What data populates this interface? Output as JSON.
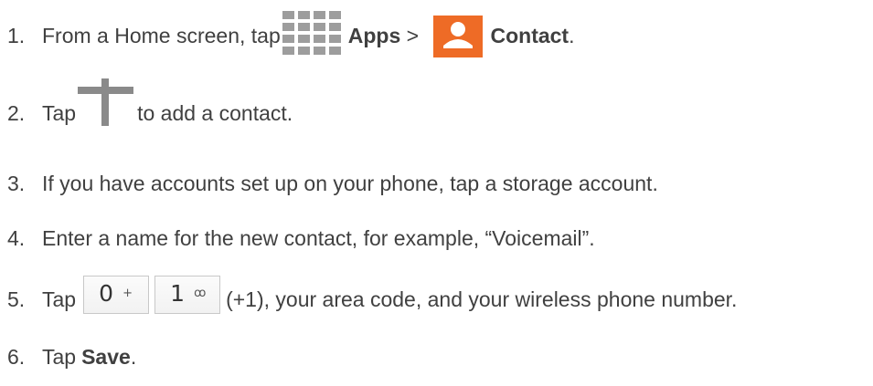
{
  "steps": [
    {
      "num": "1.",
      "pre": "From a Home screen, tap",
      "apps_label": "Apps",
      "sep": " > ",
      "contact_label": "Contact",
      "end": ".",
      "icons": [
        "apps-grid-icon",
        "contact-person-icon"
      ],
      "colors": {
        "apps_icon": "#9d9d9d",
        "contact_icon": "#ee6b26"
      }
    },
    {
      "num": "2.",
      "pre": "Tap",
      "post": "to add a contact.",
      "icons": [
        "plus-icon"
      ],
      "colors": {
        "plus_icon": "#8a8a8a"
      }
    },
    {
      "num": "3.",
      "text": "If you have accounts set up on your phone, tap a storage account."
    },
    {
      "num": "4.",
      "text": "Enter a name for the new contact, for example, “Voicemail”."
    },
    {
      "num": "5.",
      "pre": "Tap",
      "key0_digit": "0",
      "key0_sub": "+",
      "key1_digit": "1",
      "key1_sub": "ꝏ",
      "post": "(+1), your area code, and your wireless phone number."
    },
    {
      "num": "6.",
      "pre": "Tap",
      "save_label": "Save",
      "end": "."
    }
  ]
}
